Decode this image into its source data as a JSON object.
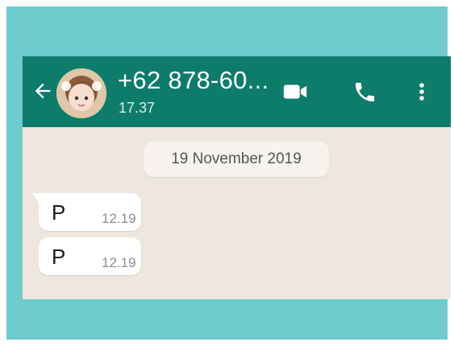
{
  "header": {
    "contact_name": "+62 878-60...",
    "status": "17.37",
    "icons": {
      "back": "back-arrow-icon",
      "video": "video-call-icon",
      "call": "phone-icon",
      "menu": "more-options-icon"
    }
  },
  "chat": {
    "date_label": "19 November 2019",
    "messages": [
      {
        "text": "P",
        "time": "12.19"
      },
      {
        "text": "P",
        "time": "12.19"
      }
    ]
  },
  "colors": {
    "outer_background": "#6ECBCE",
    "header": "#0E7C6B",
    "chat_background": "#EEE7DE",
    "bubble": "#FFFFFF"
  }
}
